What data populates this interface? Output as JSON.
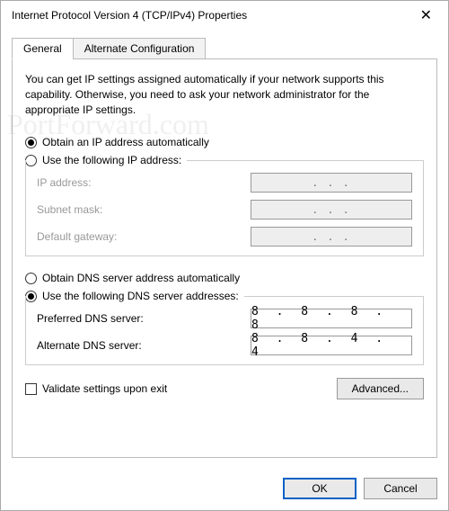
{
  "window": {
    "title": "Internet Protocol Version 4 (TCP/IPv4) Properties"
  },
  "tabs": {
    "general": "General",
    "alternate": "Alternate Configuration"
  },
  "description": "You can get IP settings assigned automatically if your network supports this capability. Otherwise, you need to ask your network administrator for the appropriate IP settings.",
  "ip": {
    "auto_label": "Obtain an IP address automatically",
    "manual_label": "Use the following IP address:",
    "fields": {
      "ip_address": {
        "label": "IP address:",
        "value": ".       .       ."
      },
      "subnet": {
        "label": "Subnet mask:",
        "value": ".       .       ."
      },
      "gateway": {
        "label": "Default gateway:",
        "value": ".       .       ."
      }
    }
  },
  "dns": {
    "auto_label": "Obtain DNS server address automatically",
    "manual_label": "Use the following DNS server addresses:",
    "fields": {
      "preferred": {
        "label": "Preferred DNS server:",
        "value": "8 . 8 . 8 . 8"
      },
      "alternate": {
        "label": "Alternate DNS server:",
        "value": "8 . 8 . 4 . 4"
      }
    }
  },
  "validate_label": "Validate settings upon exit",
  "buttons": {
    "advanced": "Advanced...",
    "ok": "OK",
    "cancel": "Cancel"
  },
  "watermark": "PortForward.com"
}
